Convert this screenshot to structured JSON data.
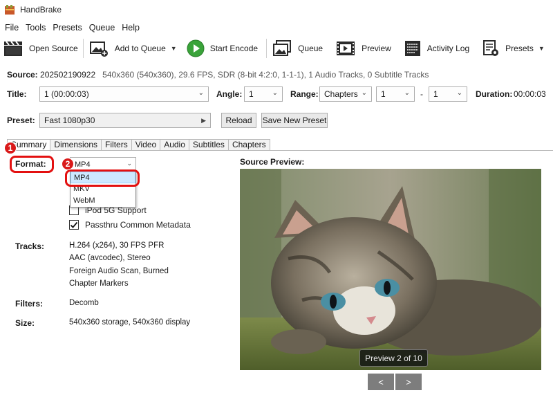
{
  "window": {
    "title": "HandBrake"
  },
  "menu": [
    "File",
    "Tools",
    "Presets",
    "Queue",
    "Help"
  ],
  "toolbar": {
    "open_source": "Open Source",
    "add_to_queue": "Add to Queue",
    "start_encode": "Start Encode",
    "queue": "Queue",
    "preview": "Preview",
    "activity_log": "Activity Log",
    "presets": "Presets"
  },
  "source": {
    "label": "Source:",
    "name": "202502190922",
    "info": "540x360 (540x360), 29.6 FPS, SDR (8-bit 4:2:0, 1-1-1), 1 Audio Tracks, 0 Subtitle Tracks"
  },
  "title_row": {
    "title_label": "Title:",
    "title_value": "1 (00:00:03)",
    "angle_label": "Angle:",
    "angle_value": "1",
    "range_label": "Range:",
    "range_mode": "Chapters",
    "range_start": "1",
    "range_dash": "-",
    "range_end": "1",
    "duration_label": "Duration:",
    "duration_value": "00:00:03"
  },
  "preset_row": {
    "label": "Preset:",
    "value": "Fast 1080p30",
    "reload": "Reload",
    "save_new": "Save New Preset"
  },
  "tabs": [
    "Summary",
    "Dimensions",
    "Filters",
    "Video",
    "Audio",
    "Subtitles",
    "Chapters"
  ],
  "summary": {
    "format_label": "Format:",
    "format_value": "MP4",
    "format_options": [
      "MP4",
      "MKV",
      "WebM"
    ],
    "ipod_label": "iPod 5G Support",
    "passthru_label": "Passthru Common Metadata",
    "tracks_label": "Tracks:",
    "tracks": [
      "H.264 (x264), 30 FPS PFR",
      "AAC (avcodec), Stereo",
      "Foreign Audio Scan, Burned",
      "Chapter Markers"
    ],
    "filters_label": "Filters:",
    "filters_value": "Decomb",
    "size_label": "Size:",
    "size_value": "540x360 storage, 540x360 display"
  },
  "preview": {
    "label": "Source Preview:",
    "badge": "Preview 2 of 10",
    "prev": "<",
    "next": ">"
  },
  "annotations": {
    "step1": "1",
    "step2": "2"
  },
  "colors": {
    "annotation_red": "#e31010",
    "play_green": "#3aa33a",
    "selection_blue": "#cde8ff"
  }
}
